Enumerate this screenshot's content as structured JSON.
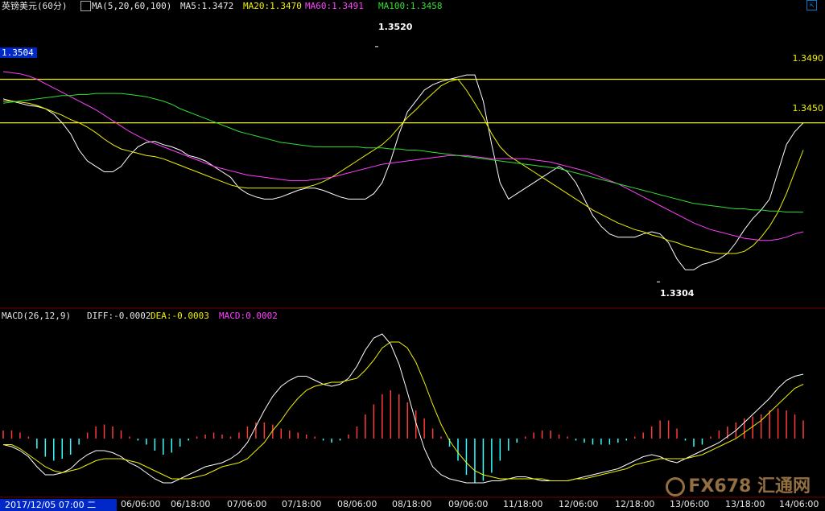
{
  "header": {
    "symbol": "英镑美元(60分)",
    "ma_spec": "MA(5,20,60,100)",
    "ma5": "MA5:1.3472",
    "ma20": "MA20:1.3470",
    "ma60": "MA60:1.3491",
    "ma100": "MA100:1.3458"
  },
  "macd_header": {
    "spec": "MACD(26,12,9)",
    "diff": "DIFF:-0.0002",
    "dea": "DEA:-0.0003",
    "macd": "MACD:0.0002"
  },
  "price_tag": "1.3504",
  "level_labels": [
    "1.3490",
    "1.3450"
  ],
  "date_box": "2017/12/05 07:00 二",
  "logo_text": "FX678 汇通网",
  "colors": {
    "up": "#ff3a3a",
    "down": "#30ffff",
    "ma5": "#ffffff",
    "ma20": "#f0f000",
    "ma60": "#ff40ff",
    "ma100": "#30e030",
    "level": "#f0f000"
  },
  "chart_data": {
    "type": "line",
    "x_ticks": [
      "06/06:00",
      "06/18:00",
      "07/06:00",
      "07/18:00",
      "08/06:00",
      "08/18:00",
      "09/06:00",
      "11/18:00",
      "12/06:00",
      "12/18:00",
      "13/06:00",
      "13/18:00",
      "14/06:00"
    ],
    "price_ylim": [
      1.3282,
      1.3548
    ],
    "annotations": [
      {
        "text": "1.3520",
        "value": 1.352
      },
      {
        "text": "1.3304",
        "value": 1.3304
      }
    ],
    "horizontal_levels": [
      1.349,
      1.345
    ],
    "series": [
      {
        "name": "MA5",
        "values": [
          1.3472,
          1.347,
          1.3468,
          1.3466,
          1.3465,
          1.3463,
          1.3458,
          1.345,
          1.344,
          1.3425,
          1.3415,
          1.341,
          1.3405,
          1.3405,
          1.341,
          1.342,
          1.3428,
          1.3432,
          1.3433,
          1.343,
          1.3428,
          1.3425,
          1.342,
          1.3418,
          1.3415,
          1.341,
          1.3405,
          1.34,
          1.339,
          1.3385,
          1.3382,
          1.338,
          1.338,
          1.3382,
          1.3385,
          1.3388,
          1.339,
          1.339,
          1.3388,
          1.3385,
          1.3382,
          1.338,
          1.338,
          1.338,
          1.3385,
          1.3395,
          1.3415,
          1.344,
          1.346,
          1.347,
          1.348,
          1.3485,
          1.3488,
          1.349,
          1.3492,
          1.3494,
          1.3494,
          1.347,
          1.343,
          1.3395,
          1.338,
          1.3385,
          1.339,
          1.3395,
          1.34,
          1.3405,
          1.341,
          1.3405,
          1.3395,
          1.338,
          1.3365,
          1.3355,
          1.3348,
          1.3345,
          1.3345,
          1.3345,
          1.3348,
          1.335,
          1.3348,
          1.334,
          1.3325,
          1.3315,
          1.3315,
          1.332,
          1.3322,
          1.3325,
          1.333,
          1.334,
          1.3352,
          1.3362,
          1.337,
          1.338,
          1.3405,
          1.343,
          1.3442,
          1.345
        ]
      },
      {
        "name": "MA20",
        "values": [
          1.347,
          1.347,
          1.3469,
          1.3468,
          1.3466,
          1.3463,
          1.346,
          1.3457,
          1.3453,
          1.345,
          1.3446,
          1.3441,
          1.3435,
          1.343,
          1.3426,
          1.3424,
          1.3422,
          1.342,
          1.3419,
          1.3417,
          1.3414,
          1.3411,
          1.3408,
          1.3405,
          1.3402,
          1.3399,
          1.3396,
          1.3393,
          1.3391,
          1.339,
          1.339,
          1.339,
          1.339,
          1.339,
          1.339,
          1.339,
          1.3391,
          1.3393,
          1.3396,
          1.34,
          1.3405,
          1.341,
          1.3415,
          1.342,
          1.3425,
          1.343,
          1.3437,
          1.3446,
          1.3455,
          1.3462,
          1.347,
          1.3477,
          1.3484,
          1.3488,
          1.349,
          1.348,
          1.3468,
          1.3455,
          1.344,
          1.3428,
          1.342,
          1.3415,
          1.341,
          1.3405,
          1.34,
          1.3395,
          1.339,
          1.3385,
          1.338,
          1.3375,
          1.337,
          1.3366,
          1.3362,
          1.3358,
          1.3355,
          1.3352,
          1.335,
          1.3347,
          1.3345,
          1.3342,
          1.334,
          1.3337,
          1.3335,
          1.3333,
          1.3331,
          1.333,
          1.333,
          1.333,
          1.3332,
          1.3337,
          1.3345,
          1.3355,
          1.3368,
          1.3385,
          1.3405,
          1.3425
        ]
      },
      {
        "name": "MA60",
        "values": [
          1.3497,
          1.3496,
          1.3495,
          1.3493,
          1.349,
          1.3486,
          1.3482,
          1.3478,
          1.3474,
          1.347,
          1.3466,
          1.3462,
          1.3457,
          1.3452,
          1.3447,
          1.3442,
          1.3438,
          1.3434,
          1.3431,
          1.3428,
          1.3425,
          1.3422,
          1.3419,
          1.3416,
          1.3413,
          1.341,
          1.3408,
          1.3406,
          1.3404,
          1.3402,
          1.3401,
          1.34,
          1.3399,
          1.3398,
          1.3397,
          1.3397,
          1.3397,
          1.3398,
          1.3399,
          1.34,
          1.3402,
          1.3404,
          1.3406,
          1.3408,
          1.341,
          1.3412,
          1.3413,
          1.3414,
          1.3415,
          1.3416,
          1.3417,
          1.3418,
          1.3419,
          1.342,
          1.342,
          1.342,
          1.3419,
          1.3418,
          1.3417,
          1.3417,
          1.3417,
          1.3417,
          1.3417,
          1.3416,
          1.3415,
          1.3414,
          1.3412,
          1.341,
          1.3408,
          1.3406,
          1.3403,
          1.34,
          1.3397,
          1.3394,
          1.339,
          1.3386,
          1.3382,
          1.3378,
          1.3374,
          1.337,
          1.3366,
          1.3362,
          1.3358,
          1.3355,
          1.3352,
          1.335,
          1.3348,
          1.3346,
          1.3344,
          1.3343,
          1.3342,
          1.3342,
          1.3343,
          1.3345,
          1.3348,
          1.335
        ]
      },
      {
        "name": "MA100",
        "values": [
          1.3468,
          1.3469,
          1.347,
          1.3471,
          1.3472,
          1.3473,
          1.3474,
          1.3475,
          1.3475,
          1.3476,
          1.3476,
          1.3477,
          1.3477,
          1.3477,
          1.3477,
          1.3476,
          1.3475,
          1.3474,
          1.3472,
          1.347,
          1.3467,
          1.3463,
          1.346,
          1.3457,
          1.3454,
          1.3451,
          1.3448,
          1.3445,
          1.3442,
          1.344,
          1.3438,
          1.3436,
          1.3434,
          1.3432,
          1.3431,
          1.343,
          1.3429,
          1.3428,
          1.3428,
          1.3428,
          1.3428,
          1.3428,
          1.3428,
          1.3427,
          1.3427,
          1.3427,
          1.3426,
          1.3426,
          1.3425,
          1.3425,
          1.3424,
          1.3423,
          1.3422,
          1.3421,
          1.342,
          1.3419,
          1.3418,
          1.3417,
          1.3416,
          1.3415,
          1.3414,
          1.3413,
          1.3412,
          1.3411,
          1.341,
          1.3409,
          1.3408,
          1.3406,
          1.3404,
          1.3402,
          1.34,
          1.3398,
          1.3396,
          1.3394,
          1.3392,
          1.339,
          1.3388,
          1.3386,
          1.3384,
          1.3382,
          1.338,
          1.3378,
          1.3376,
          1.3375,
          1.3374,
          1.3373,
          1.3372,
          1.3371,
          1.3371,
          1.337,
          1.337,
          1.3369,
          1.3369,
          1.3368,
          1.3368,
          1.3368
        ]
      }
    ],
    "macd": {
      "hist": [
        0.0004,
        0.0004,
        0.0003,
        0.0001,
        -0.0005,
        -0.0009,
        -0.0011,
        -0.001,
        -0.0008,
        -0.0003,
        0.0003,
        0.0006,
        0.0007,
        0.0006,
        0.0004,
        0.0001,
        -0.0001,
        -0.0003,
        -0.0006,
        -0.0008,
        -0.0007,
        -0.0004,
        -0.0001,
        0.0001,
        0.0002,
        0.0003,
        0.0002,
        0.0001,
        0.0003,
        0.0006,
        0.0008,
        0.0008,
        0.0007,
        0.0005,
        0.0004,
        0.0003,
        0.0002,
        0.0001,
        -0.0001,
        -0.0002,
        -0.0001,
        0.0002,
        0.0006,
        0.0012,
        0.0017,
        0.0022,
        0.0024,
        0.0022,
        0.0018,
        0.0014,
        0.001,
        0.0005,
        0.0001,
        -0.0004,
        -0.0011,
        -0.0018,
        -0.0022,
        -0.0021,
        -0.0017,
        -0.0011,
        -0.0006,
        -0.0002,
        0.0001,
        0.0003,
        0.0004,
        0.0004,
        0.0002,
        0.0001,
        -0.0001,
        -0.0002,
        -0.0003,
        -0.0003,
        -0.0003,
        -0.0002,
        -0.0001,
        0.0001,
        0.0003,
        0.0006,
        0.0009,
        0.0009,
        0.0005,
        -0.0001,
        -0.0004,
        -0.0003,
        0.0001,
        0.0004,
        0.0006,
        0.0008,
        0.001,
        0.0011,
        0.0012,
        0.0014,
        0.0015,
        0.0014,
        0.0012,
        0.0009
      ],
      "diff": [
        -0.0003,
        -0.0004,
        -0.0006,
        -0.0009,
        -0.0014,
        -0.0018,
        -0.0018,
        -0.0017,
        -0.0015,
        -0.0011,
        -0.0008,
        -0.0006,
        -0.0006,
        -0.0007,
        -0.0009,
        -0.0012,
        -0.0014,
        -0.0017,
        -0.002,
        -0.0022,
        -0.0022,
        -0.002,
        -0.0018,
        -0.0016,
        -0.0014,
        -0.0013,
        -0.0012,
        -0.001,
        -0.0007,
        -0.0002,
        0.0006,
        0.0014,
        0.0021,
        0.0026,
        0.0029,
        0.0031,
        0.0031,
        0.0029,
        0.0027,
        0.0026,
        0.0027,
        0.003,
        0.0036,
        0.0044,
        0.005,
        0.0052,
        0.0047,
        0.0037,
        0.0023,
        0.0008,
        -0.0005,
        -0.0014,
        -0.0018,
        -0.002,
        -0.0021,
        -0.0022,
        -0.0022,
        -0.0022,
        -0.0021,
        -0.0021,
        -0.002,
        -0.0019,
        -0.0019,
        -0.002,
        -0.0021,
        -0.0021,
        -0.0021,
        -0.0021,
        -0.002,
        -0.0019,
        -0.0018,
        -0.0017,
        -0.0016,
        -0.0015,
        -0.0013,
        -0.0011,
        -0.0009,
        -0.0008,
        -0.0009,
        -0.0011,
        -0.0012,
        -0.001,
        -0.0008,
        -0.0006,
        -0.0004,
        -0.0002,
        0.0001,
        0.0004,
        0.0008,
        0.0012,
        0.0016,
        0.002,
        0.0025,
        0.0029,
        0.0031,
        0.0032
      ],
      "dea": [
        -0.0003,
        -0.0003,
        -0.0005,
        -0.0008,
        -0.0011,
        -0.0014,
        -0.0016,
        -0.0017,
        -0.0016,
        -0.0015,
        -0.0013,
        -0.0011,
        -0.001,
        -0.001,
        -0.001,
        -0.0011,
        -0.0012,
        -0.0014,
        -0.0016,
        -0.0018,
        -0.002,
        -0.002,
        -0.002,
        -0.0019,
        -0.0018,
        -0.0016,
        -0.0014,
        -0.0013,
        -0.0012,
        -0.001,
        -0.0006,
        -0.0002,
        0.0004,
        0.0009,
        0.0015,
        0.002,
        0.0024,
        0.0026,
        0.0027,
        0.0028,
        0.0028,
        0.0029,
        0.003,
        0.0034,
        0.0039,
        0.0045,
        0.0048,
        0.0048,
        0.0045,
        0.0038,
        0.0028,
        0.0017,
        0.0007,
        -0.0001,
        -0.0007,
        -0.0012,
        -0.0016,
        -0.0018,
        -0.0019,
        -0.002,
        -0.002,
        -0.002,
        -0.002,
        -0.002,
        -0.002,
        -0.0021,
        -0.0021,
        -0.0021,
        -0.002,
        -0.002,
        -0.0019,
        -0.0018,
        -0.0017,
        -0.0016,
        -0.0015,
        -0.0013,
        -0.0012,
        -0.0011,
        -0.001,
        -0.001,
        -0.001,
        -0.001,
        -0.0009,
        -0.0008,
        -0.0006,
        -0.0004,
        -0.0002,
        0,
        0.0003,
        0.0006,
        0.0009,
        0.0013,
        0.0017,
        0.0021,
        0.0025,
        0.0027
      ]
    }
  }
}
